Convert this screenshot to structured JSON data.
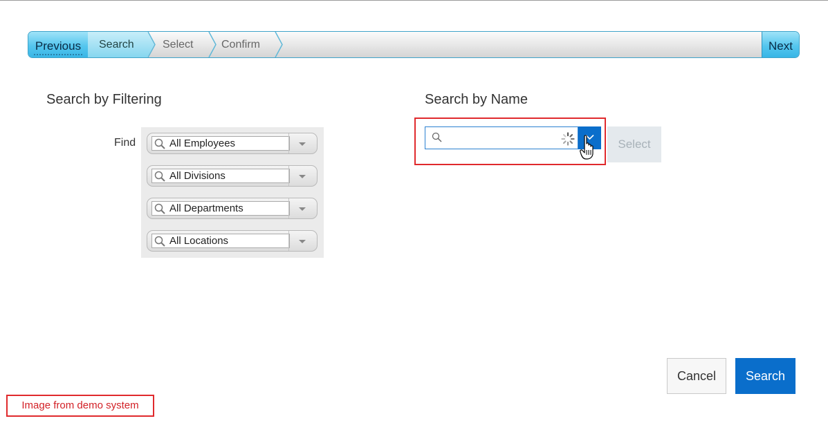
{
  "wizard": {
    "previous_label": "Previous",
    "next_label": "Next",
    "steps": [
      {
        "label": "Search",
        "active": true
      },
      {
        "label": "Select",
        "active": false
      },
      {
        "label": "Confirm",
        "active": false
      }
    ]
  },
  "filter": {
    "heading": "Search by Filtering",
    "find_label": "Find",
    "fields": [
      {
        "value": "All Employees"
      },
      {
        "value": "All Divisions"
      },
      {
        "value": "All Departments"
      },
      {
        "value": "All Locations"
      }
    ]
  },
  "name_search": {
    "heading": "Search by Name",
    "input_value": "",
    "select_label": "Select"
  },
  "actions": {
    "cancel_label": "Cancel",
    "search_label": "Search"
  },
  "note": "Image from demo system",
  "colors": {
    "accent_blue": "#0a6ecb",
    "wizard_blue": "#55c6ee",
    "highlight_red": "#e0292c"
  }
}
